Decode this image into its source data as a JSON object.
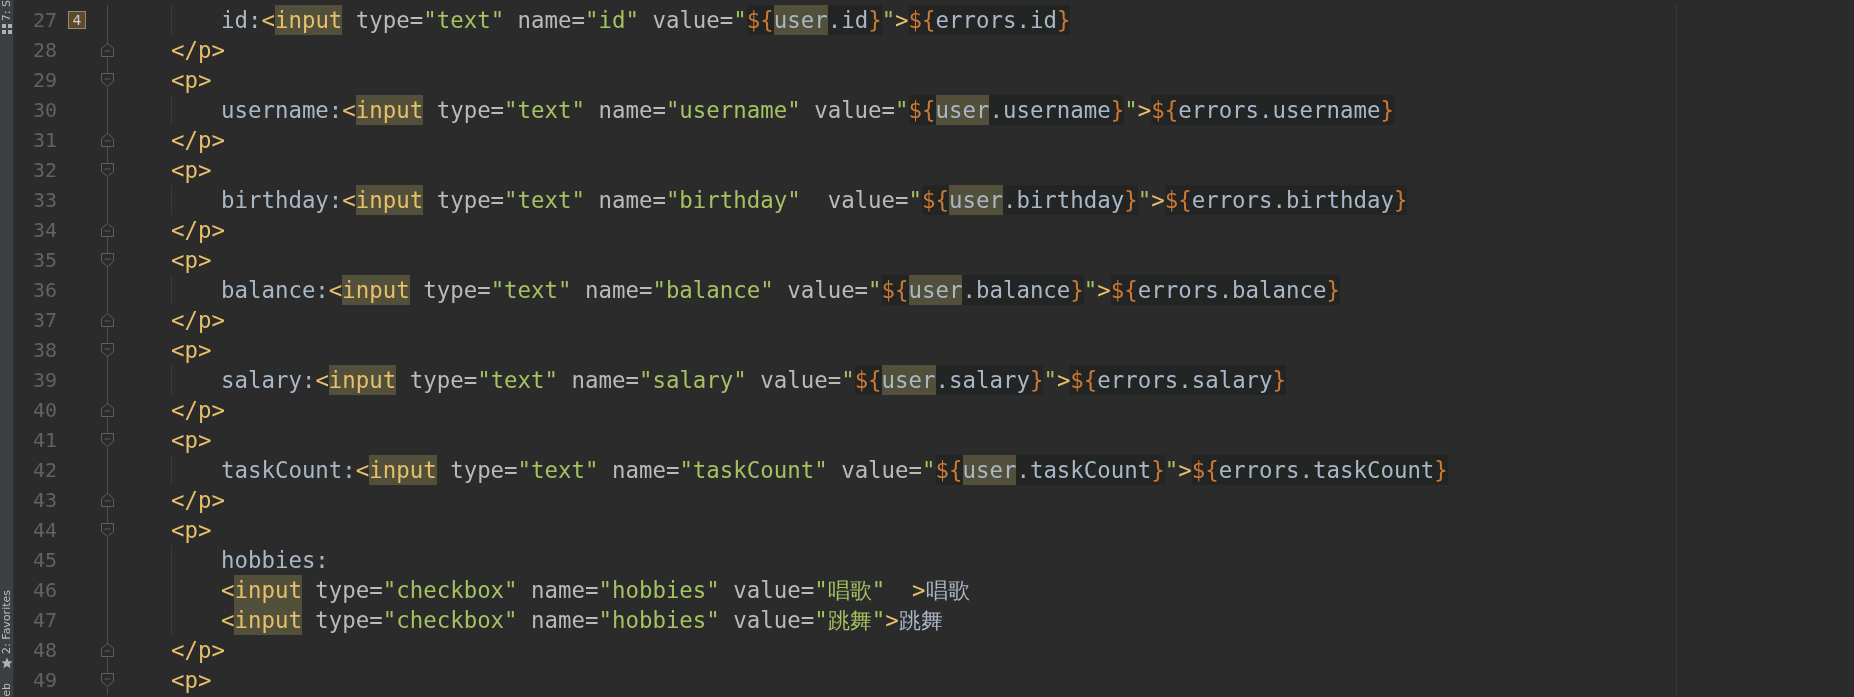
{
  "tool_strip": {
    "top": [
      {
        "label": "7: S"
      }
    ],
    "bottom": [
      {
        "label": "2: Favorites"
      },
      {
        "label": "eb"
      }
    ]
  },
  "editor": {
    "lines": [
      {
        "number": "27",
        "kind": "content",
        "bookmark": "4",
        "tokens": [
          {
            "kind": "text",
            "text": "id:"
          },
          {
            "kind": "tag",
            "text": "<"
          },
          {
            "kind": "tag",
            "text": "input",
            "highlighted": true
          },
          {
            "kind": "attr",
            "text": " type="
          },
          {
            "kind": "string",
            "text": "\"text\""
          },
          {
            "kind": "attr",
            "text": " name="
          },
          {
            "kind": "string",
            "text": "\"id\""
          },
          {
            "kind": "attr",
            "text": " value="
          },
          {
            "kind": "string",
            "text": "\""
          },
          {
            "kind": "el",
            "text": "${",
            "expression": true
          },
          {
            "kind": "el_text",
            "text": "user",
            "expression": true,
            "highlighted": true
          },
          {
            "kind": "el_text",
            "text": ".id",
            "expression": true
          },
          {
            "kind": "el",
            "text": "}",
            "expression": true
          },
          {
            "kind": "string",
            "text": "\""
          },
          {
            "kind": "tag",
            "text": ">"
          },
          {
            "kind": "el",
            "text": "${",
            "expression": true
          },
          {
            "kind": "el_text",
            "text": "errors.id",
            "expression": true
          },
          {
            "kind": "el",
            "text": "}",
            "expression": true
          }
        ]
      },
      {
        "number": "28",
        "kind": "close_tag",
        "tokens": [
          {
            "kind": "tag",
            "text": "</p>"
          }
        ]
      },
      {
        "number": "29",
        "kind": "open_tag",
        "tokens": [
          {
            "kind": "tag",
            "text": "<p>"
          }
        ]
      },
      {
        "number": "30",
        "kind": "content",
        "tokens": [
          {
            "kind": "text",
            "text": "username:"
          },
          {
            "kind": "tag",
            "text": "<"
          },
          {
            "kind": "tag",
            "text": "input",
            "highlighted": true
          },
          {
            "kind": "attr",
            "text": " type="
          },
          {
            "kind": "string",
            "text": "\"text\""
          },
          {
            "kind": "attr",
            "text": " name="
          },
          {
            "kind": "string",
            "text": "\"username\""
          },
          {
            "kind": "attr",
            "text": " value="
          },
          {
            "kind": "string",
            "text": "\""
          },
          {
            "kind": "el",
            "text": "${",
            "expression": true
          },
          {
            "kind": "el_text",
            "text": "user",
            "expression": true,
            "highlighted": true
          },
          {
            "kind": "el_text",
            "text": ".username",
            "expression": true
          },
          {
            "kind": "el",
            "text": "}",
            "expression": true
          },
          {
            "kind": "string",
            "text": "\""
          },
          {
            "kind": "tag",
            "text": ">"
          },
          {
            "kind": "el",
            "text": "${",
            "expression": true
          },
          {
            "kind": "el_text",
            "text": "errors.username",
            "expression": true
          },
          {
            "kind": "el",
            "text": "}",
            "expression": true
          }
        ]
      },
      {
        "number": "31",
        "kind": "close_tag",
        "tokens": [
          {
            "kind": "tag",
            "text": "</p>"
          }
        ]
      },
      {
        "number": "32",
        "kind": "open_tag",
        "tokens": [
          {
            "kind": "tag",
            "text": "<p>"
          }
        ]
      },
      {
        "number": "33",
        "kind": "content",
        "tokens": [
          {
            "kind": "text",
            "text": "birthday:"
          },
          {
            "kind": "tag",
            "text": "<"
          },
          {
            "kind": "tag",
            "text": "input",
            "highlighted": true
          },
          {
            "kind": "attr",
            "text": " type="
          },
          {
            "kind": "string",
            "text": "\"text\""
          },
          {
            "kind": "attr",
            "text": " name="
          },
          {
            "kind": "string",
            "text": "\"birthday\""
          },
          {
            "kind": "attr",
            "text": "  value="
          },
          {
            "kind": "string",
            "text": "\""
          },
          {
            "kind": "el",
            "text": "${",
            "expression": true
          },
          {
            "kind": "el_text",
            "text": "user",
            "expression": true,
            "highlighted": true
          },
          {
            "kind": "el_text",
            "text": ".birthday",
            "expression": true
          },
          {
            "kind": "el",
            "text": "}",
            "expression": true
          },
          {
            "kind": "string",
            "text": "\""
          },
          {
            "kind": "tag",
            "text": ">"
          },
          {
            "kind": "el",
            "text": "${",
            "expression": true
          },
          {
            "kind": "el_text",
            "text": "errors.birthday",
            "expression": true
          },
          {
            "kind": "el",
            "text": "}",
            "expression": true
          }
        ]
      },
      {
        "number": "34",
        "kind": "close_tag",
        "tokens": [
          {
            "kind": "tag",
            "text": "</p>"
          }
        ]
      },
      {
        "number": "35",
        "kind": "open_tag",
        "tokens": [
          {
            "kind": "tag",
            "text": "<p>"
          }
        ]
      },
      {
        "number": "36",
        "kind": "content",
        "tokens": [
          {
            "kind": "text",
            "text": "balance:"
          },
          {
            "kind": "tag",
            "text": "<"
          },
          {
            "kind": "tag",
            "text": "input",
            "highlighted": true
          },
          {
            "kind": "attr",
            "text": " type="
          },
          {
            "kind": "string",
            "text": "\"text\""
          },
          {
            "kind": "attr",
            "text": " name="
          },
          {
            "kind": "string",
            "text": "\"balance\""
          },
          {
            "kind": "attr",
            "text": " value="
          },
          {
            "kind": "string",
            "text": "\""
          },
          {
            "kind": "el",
            "text": "${",
            "expression": true
          },
          {
            "kind": "el_text",
            "text": "user",
            "expression": true,
            "highlighted": true
          },
          {
            "kind": "el_text",
            "text": ".balance",
            "expression": true
          },
          {
            "kind": "el",
            "text": "}",
            "expression": true
          },
          {
            "kind": "string",
            "text": "\""
          },
          {
            "kind": "tag",
            "text": ">"
          },
          {
            "kind": "el",
            "text": "${",
            "expression": true
          },
          {
            "kind": "el_text",
            "text": "errors.balance",
            "expression": true
          },
          {
            "kind": "el",
            "text": "}",
            "expression": true
          }
        ]
      },
      {
        "number": "37",
        "kind": "close_tag",
        "tokens": [
          {
            "kind": "tag",
            "text": "</p>"
          }
        ]
      },
      {
        "number": "38",
        "kind": "open_tag",
        "tokens": [
          {
            "kind": "tag",
            "text": "<p>"
          }
        ]
      },
      {
        "number": "39",
        "kind": "content",
        "tokens": [
          {
            "kind": "text",
            "text": "salary:"
          },
          {
            "kind": "tag",
            "text": "<"
          },
          {
            "kind": "tag",
            "text": "input",
            "highlighted": true
          },
          {
            "kind": "attr",
            "text": " type="
          },
          {
            "kind": "string",
            "text": "\"text\""
          },
          {
            "kind": "attr",
            "text": " name="
          },
          {
            "kind": "string",
            "text": "\"salary\""
          },
          {
            "kind": "attr",
            "text": " value="
          },
          {
            "kind": "string",
            "text": "\""
          },
          {
            "kind": "el",
            "text": "${",
            "expression": true
          },
          {
            "kind": "el_text",
            "text": "user",
            "expression": true,
            "highlighted": true
          },
          {
            "kind": "el_text",
            "text": ".salary",
            "expression": true
          },
          {
            "kind": "el",
            "text": "}",
            "expression": true
          },
          {
            "kind": "string",
            "text": "\""
          },
          {
            "kind": "tag",
            "text": ">"
          },
          {
            "kind": "el",
            "text": "${",
            "expression": true
          },
          {
            "kind": "el_text",
            "text": "errors.salary",
            "expression": true
          },
          {
            "kind": "el",
            "text": "}",
            "expression": true
          }
        ]
      },
      {
        "number": "40",
        "kind": "close_tag",
        "tokens": [
          {
            "kind": "tag",
            "text": "</p>"
          }
        ]
      },
      {
        "number": "41",
        "kind": "open_tag",
        "tokens": [
          {
            "kind": "tag",
            "text": "<p>"
          }
        ]
      },
      {
        "number": "42",
        "kind": "content",
        "tokens": [
          {
            "kind": "text",
            "text": "taskCount:"
          },
          {
            "kind": "tag",
            "text": "<"
          },
          {
            "kind": "tag",
            "text": "input",
            "highlighted": true
          },
          {
            "kind": "attr",
            "text": " type="
          },
          {
            "kind": "string",
            "text": "\"text\""
          },
          {
            "kind": "attr",
            "text": " name="
          },
          {
            "kind": "string",
            "text": "\"taskCount\""
          },
          {
            "kind": "attr",
            "text": " value="
          },
          {
            "kind": "string",
            "text": "\""
          },
          {
            "kind": "el",
            "text": "${",
            "expression": true
          },
          {
            "kind": "el_text",
            "text": "user",
            "expression": true,
            "highlighted": true
          },
          {
            "kind": "el_text",
            "text": ".taskCount",
            "expression": true
          },
          {
            "kind": "el",
            "text": "}",
            "expression": true
          },
          {
            "kind": "string",
            "text": "\""
          },
          {
            "kind": "tag",
            "text": ">"
          },
          {
            "kind": "el",
            "text": "${",
            "expression": true
          },
          {
            "kind": "el_text",
            "text": "errors.taskCount",
            "expression": true
          },
          {
            "kind": "el",
            "text": "}",
            "expression": true
          }
        ]
      },
      {
        "number": "43",
        "kind": "close_tag",
        "tokens": [
          {
            "kind": "tag",
            "text": "</p>"
          }
        ]
      },
      {
        "number": "44",
        "kind": "open_tag",
        "tokens": [
          {
            "kind": "tag",
            "text": "<p>"
          }
        ]
      },
      {
        "number": "45",
        "kind": "content",
        "tokens": [
          {
            "kind": "text",
            "text": "hobbies:"
          }
        ]
      },
      {
        "number": "46",
        "kind": "content",
        "tokens": [
          {
            "kind": "tag",
            "text": "<"
          },
          {
            "kind": "tag",
            "text": "input",
            "highlighted": true
          },
          {
            "kind": "attr",
            "text": " type="
          },
          {
            "kind": "string",
            "text": "\"checkbox\""
          },
          {
            "kind": "attr",
            "text": " name="
          },
          {
            "kind": "string",
            "text": "\"hobbies\""
          },
          {
            "kind": "attr",
            "text": " value="
          },
          {
            "kind": "string",
            "text": "\"唱歌\""
          },
          {
            "kind": "tag",
            "text": "  >"
          },
          {
            "kind": "text",
            "text": "唱歌"
          }
        ]
      },
      {
        "number": "47",
        "kind": "content",
        "tokens": [
          {
            "kind": "tag",
            "text": "<"
          },
          {
            "kind": "tag",
            "text": "input",
            "highlighted": true
          },
          {
            "kind": "attr",
            "text": " type="
          },
          {
            "kind": "string",
            "text": "\"checkbox\""
          },
          {
            "kind": "attr",
            "text": " name="
          },
          {
            "kind": "string",
            "text": "\"hobbies\""
          },
          {
            "kind": "attr",
            "text": " value="
          },
          {
            "kind": "string",
            "text": "\"跳舞\""
          },
          {
            "kind": "tag",
            "text": ">"
          },
          {
            "kind": "text",
            "text": "跳舞"
          }
        ]
      },
      {
        "number": "48",
        "kind": "close_tag",
        "tokens": [
          {
            "kind": "tag",
            "text": "</p>"
          }
        ]
      },
      {
        "number": "49",
        "kind": "open_tag",
        "tokens": [
          {
            "kind": "tag",
            "text": "<p>"
          }
        ]
      }
    ]
  }
}
